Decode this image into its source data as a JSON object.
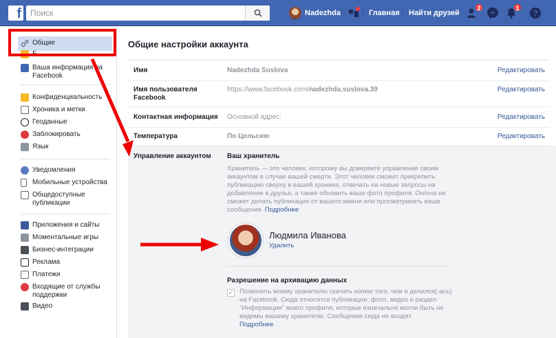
{
  "topbar": {
    "logo": "f",
    "search_placeholder": "Поиск",
    "user_name": "Nadezhda",
    "home_label": "Главная",
    "find_friends_label": "Найти друзей",
    "friend_requests_count": "2",
    "notifications_count": "1",
    "brand_color": "#4267b2"
  },
  "sidebar": {
    "items": [
      {
        "label": "Общие",
        "icon": "gears-icon"
      },
      {
        "label": "Б",
        "icon": "security-icon"
      },
      {
        "label": "Ваша информация на Facebook",
        "icon": "facebook-icon"
      },
      {
        "label": "Конфиденциальность",
        "icon": "lock-icon"
      },
      {
        "label": "Хроника и метки",
        "icon": "timeline-icon"
      },
      {
        "label": "Геоданные",
        "icon": "location-icon"
      },
      {
        "label": "Заблокировать",
        "icon": "block-icon"
      },
      {
        "label": "Язык",
        "icon": "language-icon"
      },
      {
        "label": "Уведомления",
        "icon": "globe-icon"
      },
      {
        "label": "Мобильные устройства",
        "icon": "mobile-icon"
      },
      {
        "label": "Общедоступные публикации",
        "icon": "rss-icon"
      },
      {
        "label": "Приложения и сайты",
        "icon": "apps-icon"
      },
      {
        "label": "Моментальные игры",
        "icon": "games-icon"
      },
      {
        "label": "Бизнес-интеграции",
        "icon": "business-icon"
      },
      {
        "label": "Реклама",
        "icon": "ads-icon"
      },
      {
        "label": "Платежи",
        "icon": "payments-icon"
      },
      {
        "label": "Входящие от службы поддержки",
        "icon": "support-icon"
      },
      {
        "label": "Видео",
        "icon": "video-icon"
      }
    ]
  },
  "main": {
    "title": "Общие настройки аккаунта",
    "rows": [
      {
        "label": "Имя",
        "value": "Nadezhda Suslova",
        "action": "Редактировать"
      },
      {
        "label": "Имя пользователя Facebook",
        "value_prefix": "https://www.facebook.com/",
        "value_bold": "nadezhda.suslova.39",
        "action": "Редактировать"
      },
      {
        "label": "Контактная информация",
        "value": "Основной адрес:",
        "action": "Редактировать"
      },
      {
        "label": "Температура",
        "value": "По Цельсию",
        "action": "Редактировать"
      }
    ],
    "account_management": {
      "label": "Управление аккаунтом",
      "heir_title": "Ваш хранитель",
      "heir_description": "Хранитель — это человек, которому вы доверяете управление своим аккаунтом в случае вашей смерти. Этот человек сможет прикрепить публикацию сверху в вашей хронике, отвечать на новые запросы на добавление в друзья, а также обновить ваше фото профиля. Он/она не сможет делать публикации от вашего имени или просматривать ваши сообщения.",
      "learn_more": "Подробнее",
      "guardian_name": "Людмила Иванова",
      "guardian_remove": "Удалить",
      "archive_title": "Разрешение на архивацию данных",
      "archive_checked": true,
      "archive_text": "Позволить моему хранителю скачать копию того, чем я делился(-ась) на Facebook. Сюда относятся публикации, фото, видео и раздел \"Информация\" моего профиля, которые изначально могли быть не видимы вашему хранителю. Сообщения сюда не входят.",
      "archive_learn_more": "Подробнее"
    }
  }
}
